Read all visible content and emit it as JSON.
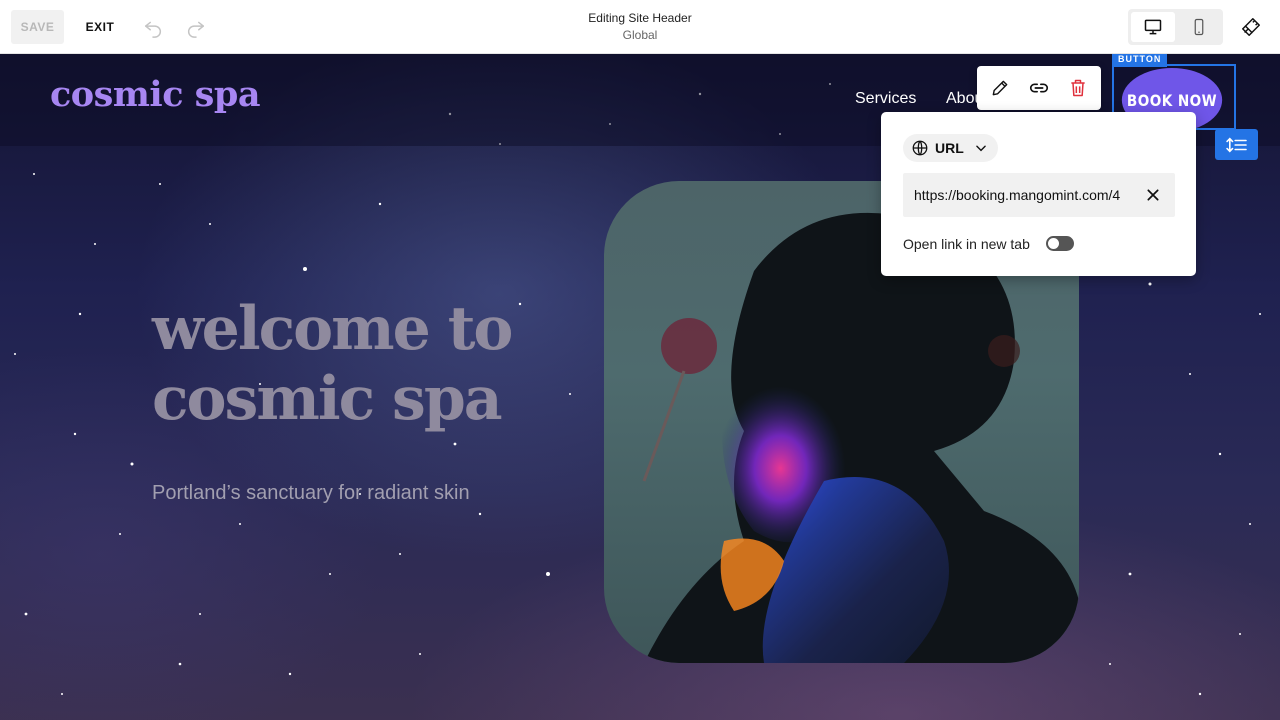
{
  "topbar": {
    "save_label": "SAVE",
    "exit_label": "EXIT",
    "title": "Editing Site Header",
    "subtitle": "Global",
    "icons": [
      "undo-icon",
      "redo-icon",
      "desktop-icon",
      "mobile-icon",
      "paintbrush-icon"
    ]
  },
  "site": {
    "logo": "cosmic spa",
    "nav": {
      "services": "Services",
      "about": "About"
    },
    "book_button": "BOOK NOW",
    "selection_tag": "BUTTON"
  },
  "toolbar": {
    "icons": [
      "pencil-icon",
      "link-icon",
      "trash-icon"
    ]
  },
  "link_popover": {
    "type_label": "URL",
    "url_value": "https://booking.mangomint.com/4",
    "new_tab_label": "Open link in new tab",
    "new_tab_enabled": false
  },
  "hero": {
    "title_line1": "welcome to",
    "title_line2": "cosmic spa",
    "subtitle": "Portland’s sanctuary for radiant skin"
  },
  "colors": {
    "accent": "#2474e5",
    "brand_purple": "#6f56e8",
    "logo_purple": "#a786f2",
    "delete_red": "#e0303c"
  }
}
